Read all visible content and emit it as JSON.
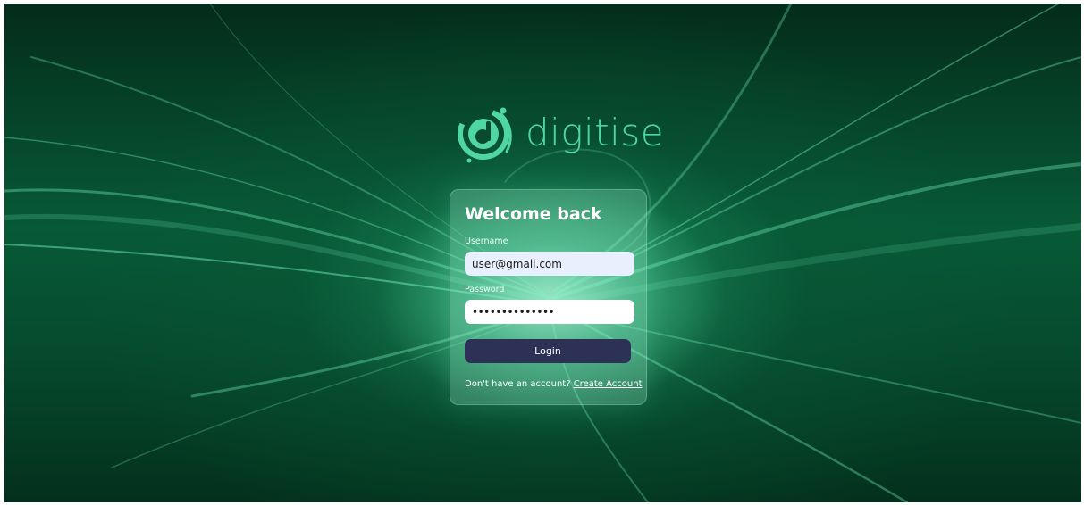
{
  "brand": {
    "name": "digitise",
    "color": "#4fd6a3"
  },
  "login_card": {
    "title": "Welcome back",
    "username_label": "Username",
    "username_value": "user@gmail.com",
    "password_label": "Password",
    "password_value": "••••••••••••••",
    "login_button": "Login",
    "signup_prompt": "Don't have an account?",
    "signup_link": "Create Account"
  },
  "colors": {
    "background": "#075a37",
    "button": "#2c3155",
    "username_field_bg": "#e8effd",
    "password_field_bg": "#ffffff"
  },
  "icons": {
    "logo": "digitise-logo-icon"
  }
}
